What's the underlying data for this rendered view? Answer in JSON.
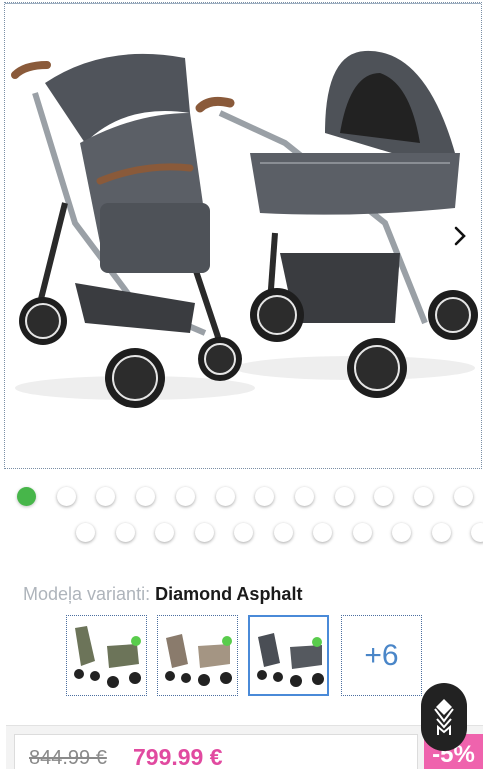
{
  "variant": {
    "label": "Modeļa varianti:",
    "value": "Diamond Asphalt"
  },
  "gallery": {
    "image_alt": "stroller-photo",
    "next_icon": "chevron-right-icon"
  },
  "pagination": {
    "total_dots": 23,
    "active_index": 0
  },
  "thumbnails": [
    {
      "name": "thumb-variant-olive",
      "color": "#6c7459",
      "selected": false,
      "available": true
    },
    {
      "name": "thumb-variant-taupe",
      "color": "#8a7b6c",
      "selected": false,
      "available": true
    },
    {
      "name": "thumb-variant-asphalt",
      "color": "#4a4e55",
      "selected": true,
      "available": true
    }
  ],
  "more_variants": "+6",
  "price": {
    "old": "844.99 €",
    "new": "799.99 €",
    "discount": "-5%"
  },
  "colors": {
    "accent_pink": "#e14aa0",
    "discount_bg": "#ef63ad",
    "active_dot": "#47b64a",
    "link_blue": "#4a86c8"
  },
  "chat_icon": "chat-logo-icon"
}
